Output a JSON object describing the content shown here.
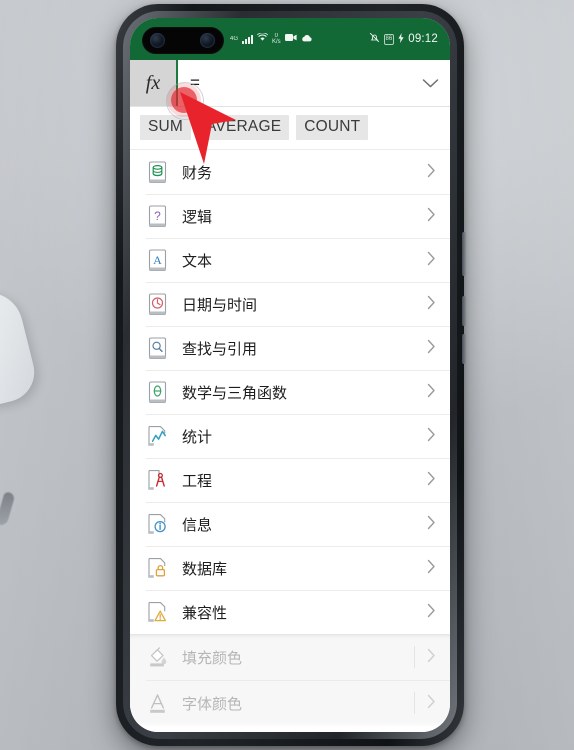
{
  "status_bar": {
    "network_type": "4G",
    "net_speed_value": "0",
    "net_speed_unit": "K/s",
    "video_icon": "video-record-icon",
    "cloud_icon": "cloud-icon",
    "mute_icon": "bell-mute-icon",
    "battery_text": "86",
    "charge_icon": "bolt-icon",
    "time": "09:12",
    "bg_color": "#126936"
  },
  "formula_bar": {
    "fx_label": "fx",
    "value": "=",
    "placeholder": "",
    "expand_icon": "chevron-down-icon",
    "accent_color": "#1a7a3f"
  },
  "quick_functions": {
    "chips": [
      {
        "label": "SUM"
      },
      {
        "label": "AVERAGE"
      },
      {
        "label": "COUNT"
      }
    ]
  },
  "categories": {
    "items": [
      {
        "label": "财务",
        "icon": "finance-icon",
        "icon_color": "#1f9254",
        "glyph": "finance"
      },
      {
        "label": "逻辑",
        "icon": "logic-icon",
        "icon_color": "#8c5fb5",
        "glyph": "question"
      },
      {
        "label": "文本",
        "icon": "text-icon",
        "icon_color": "#2f7ec4",
        "glyph": "A"
      },
      {
        "label": "日期与时间",
        "icon": "datetime-icon",
        "icon_color": "#d45f6b",
        "glyph": "clock"
      },
      {
        "label": "查找与引用",
        "icon": "lookup-icon",
        "icon_color": "#5b7f9e",
        "glyph": "magnifier"
      },
      {
        "label": "数学与三角函数",
        "icon": "math-icon",
        "icon_color": "#3da36a",
        "glyph": "theta"
      },
      {
        "label": "统计",
        "icon": "statistics-icon",
        "icon_color": "#2f9ec4",
        "glyph": "chart"
      },
      {
        "label": "工程",
        "icon": "engineering-icon",
        "icon_color": "#c72b34",
        "glyph": "compass"
      },
      {
        "label": "信息",
        "icon": "information-icon",
        "icon_color": "#3d93c9",
        "glyph": "info"
      },
      {
        "label": "数据库",
        "icon": "database-icon",
        "icon_color": "#e0a13a",
        "glyph": "lock"
      },
      {
        "label": "兼容性",
        "icon": "compatibility-icon",
        "icon_color": "#e2a93c",
        "glyph": "warning"
      }
    ],
    "chevron_icon": "chevron-right-icon"
  },
  "disabled_tools": {
    "items": [
      {
        "label": "填充颜色",
        "icon": "fill-color-icon"
      },
      {
        "label": "字体颜色",
        "icon": "font-color-icon"
      }
    ],
    "chevron_icon": "chevron-right-icon"
  },
  "overlay": {
    "tap_indicator": "tap-indicator",
    "cursor": "cursor-arrow",
    "tap_color": "#e2242c"
  }
}
